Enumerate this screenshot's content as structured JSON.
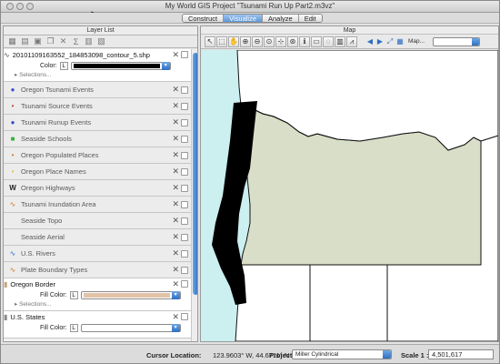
{
  "window": {
    "title": "My World GIS Project \"Tsunami Run Up Part2.m3vz\""
  },
  "modes": [
    "Construct",
    "Visualize",
    "Analyze",
    "Edit"
  ],
  "active_mode": "Visualize",
  "layer_panel": {
    "title": "Layer List",
    "expanded_top": {
      "name": "20101109163552_184853098_contour_5.shp",
      "color_label": "Color:",
      "color": "#000000",
      "selections": "Selections..."
    },
    "layers": [
      {
        "name": "Oregon Tsunami Events",
        "icon": "dot-icon",
        "color": "#3a4fc8"
      },
      {
        "name": "Tsunami Source Events",
        "icon": "dot-icon",
        "color": "#c83a3a"
      },
      {
        "name": "Tsunami Runup Events",
        "icon": "dot-icon",
        "color": "#3a4fc8"
      },
      {
        "name": "Seaside Schools",
        "icon": "square-icon",
        "color": "#33b33a"
      },
      {
        "name": "Oregon Populated Places",
        "icon": "dot-icon",
        "color": "#d07a2a"
      },
      {
        "name": "Oregon Place Names",
        "icon": "dot-icon",
        "color": "#d9c84a"
      },
      {
        "name": "Oregon Highways",
        "icon": "line-icon",
        "color": "#222222"
      },
      {
        "name": "Tsunami Inundation Area",
        "icon": "line-icon",
        "color": "#d07a2a"
      },
      {
        "name": "Seaside Topo",
        "icon": "",
        "color": ""
      },
      {
        "name": "Seaside Aerial",
        "icon": "",
        "color": ""
      },
      {
        "name": "U.S. Rivers",
        "icon": "line-icon",
        "color": "#3a6fd0"
      },
      {
        "name": "Plate Boundary Types",
        "icon": "line-icon",
        "color": "#d07a2a"
      }
    ],
    "expanded_bottom": {
      "name": "Oregon Border",
      "fill_label": "Fill Color:",
      "fill": "#e2c3a8",
      "selections": "Selections..."
    },
    "expanded_last": {
      "name": "U.S. States",
      "fill_label": "Fill Color:"
    }
  },
  "map_panel": {
    "title": "Map",
    "map_label": "Map...",
    "ocean_color": "#cceff0",
    "land_color": "#d9dec8"
  },
  "statusbar": {
    "cursor_label": "Cursor Location:",
    "cursor_value": "123.9603° W, 44.6711° N",
    "projection_label": "Projection:",
    "projection_value": "Miller Cylindrical",
    "scale_label": "Scale 1 :",
    "scale_value": "4,501,617"
  }
}
